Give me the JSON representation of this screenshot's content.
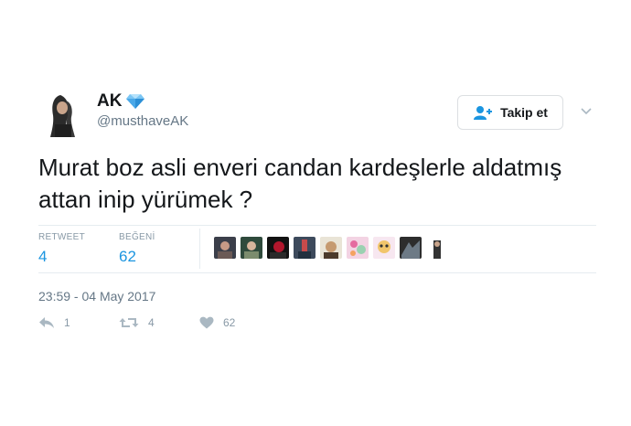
{
  "user": {
    "display_name": "AK",
    "handle": "@musthaveAK",
    "verified_badge_icon": "diamond-emoji"
  },
  "follow_button": {
    "label": "Takip et",
    "icon": "add-user-icon"
  },
  "tweet": {
    "text": "Murat boz asli enveri candan kardeşlerle aldatmış attan inip yürümek ?"
  },
  "stats": {
    "retweets_label": "RETWEET",
    "retweets_count": "4",
    "likes_label": "BEĞENİ",
    "likes_count": "62"
  },
  "likers": {
    "count_shown": 9
  },
  "timestamp": "23:59 - 04 May 2017",
  "actions": {
    "reply_count": "1",
    "retweet_count": "4",
    "like_count": "62"
  },
  "colors": {
    "accent": "#1b95e0",
    "muted": "#657786",
    "icon_gray": "#aab8c2",
    "text": "#14171a",
    "divider": "#e6ecf0"
  }
}
